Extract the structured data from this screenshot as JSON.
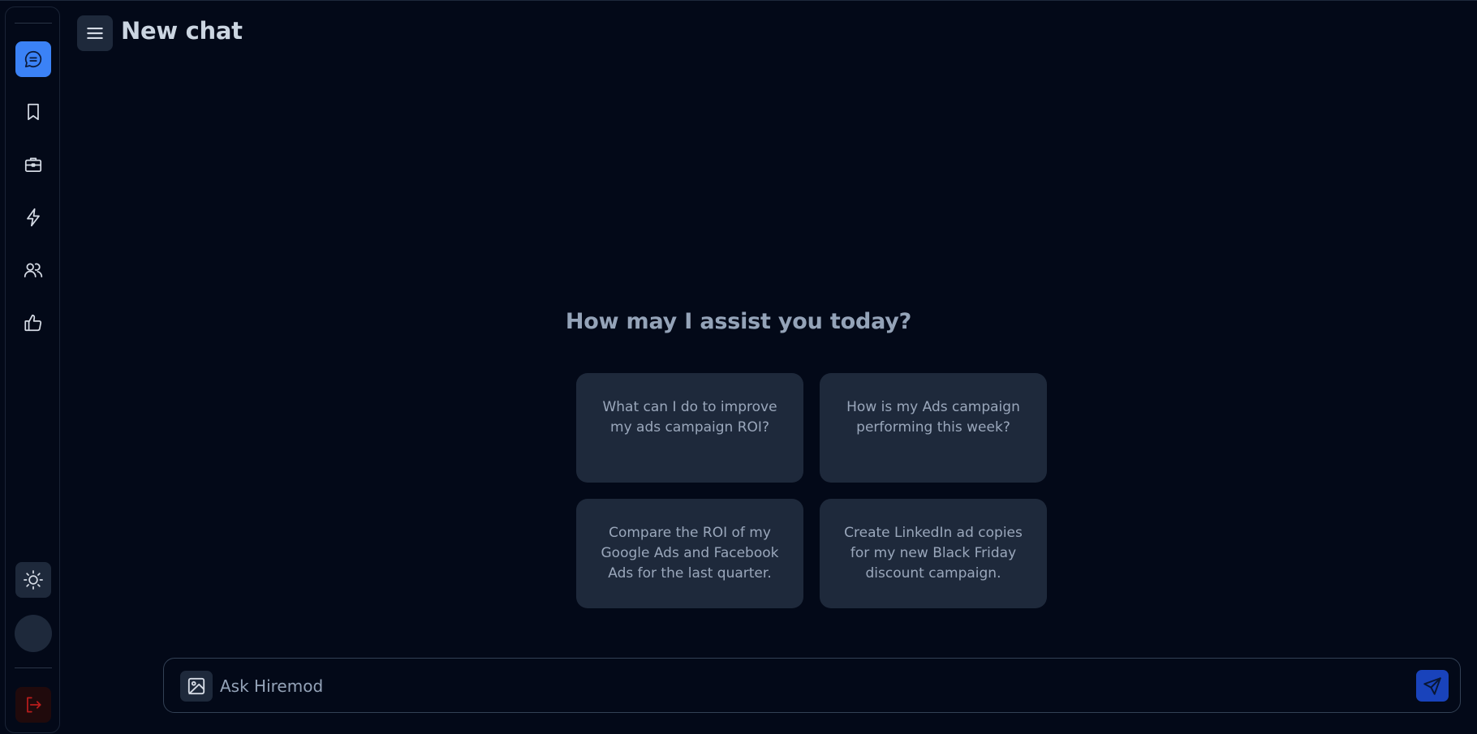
{
  "header": {
    "title": "New chat",
    "menu_icon": "hamburger-menu-icon"
  },
  "sidebar": {
    "items": [
      {
        "icon": "chat-bubble-icon",
        "active": true
      },
      {
        "icon": "bookmark-icon"
      },
      {
        "icon": "briefcase-icon"
      },
      {
        "icon": "lightning-icon"
      },
      {
        "icon": "users-icon"
      },
      {
        "icon": "thumbs-up-icon"
      }
    ],
    "bottom": [
      {
        "icon": "sun-icon"
      },
      {
        "icon": "avatar"
      },
      {
        "icon": "logout-icon"
      }
    ]
  },
  "main": {
    "heading": "How may I assist you today?",
    "suggestions": [
      "What can I do to improve my ads campaign ROI?",
      "How is my Ads campaign performing this week?",
      "Compare the ROI of my Google Ads and Facebook Ads for the last quarter.",
      "Create LinkedIn ad copies for my new Black Friday discount campaign."
    ]
  },
  "input": {
    "placeholder": "Ask Hiremod",
    "value": "",
    "attach_icon": "image-icon",
    "send_icon": "send-icon"
  },
  "colors": {
    "background": "#030918",
    "card": "#1e293b",
    "accent": "#3b82f6",
    "logout": "#b91c1c"
  }
}
